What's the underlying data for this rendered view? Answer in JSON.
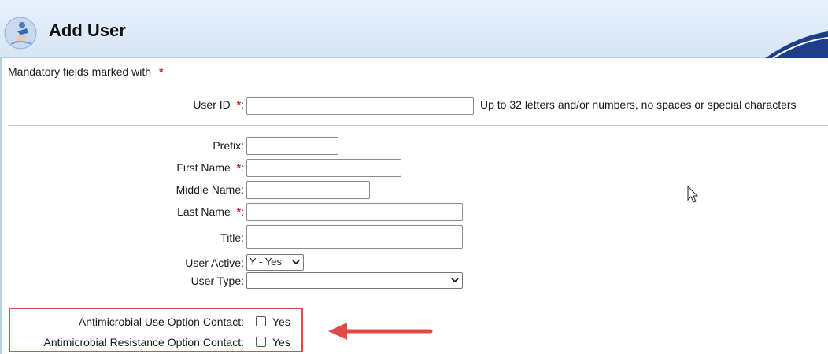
{
  "header": {
    "title": "Add User"
  },
  "mandatory_note": {
    "text": "Mandatory fields marked with",
    "star": "*"
  },
  "user_id": {
    "label": "User ID",
    "colon": ":",
    "value": "",
    "hint": "Up to 32 letters and/or numbers, no spaces or special characters"
  },
  "fields": {
    "prefix": {
      "label": "Prefix",
      "value": ""
    },
    "first_name": {
      "label": "First Name",
      "value": ""
    },
    "middle_name": {
      "label": "Middle Name",
      "value": ""
    },
    "last_name": {
      "label": "Last Name",
      "value": ""
    },
    "title": {
      "label": "Title",
      "value": ""
    },
    "user_active": {
      "label": "User Active",
      "value": "Y - Yes"
    },
    "user_type": {
      "label": "User Type",
      "value": ""
    }
  },
  "required_star": "*",
  "colon": ":",
  "contacts": {
    "use": {
      "label": "Antimicrobial Use Option Contact:",
      "option": "Yes",
      "checked": false
    },
    "resistance": {
      "label": "Antimicrobial Resistance Option Contact:",
      "option": "Yes",
      "checked": false
    }
  },
  "colors": {
    "header_bg": "#d7e6f6",
    "required_star": "#e02020",
    "highlight": "#e24a4a"
  },
  "icons": {
    "logo": "nhsn-logo-icon",
    "select_chevron": "chevron-down-icon",
    "annotation_arrow": "arrow-left-icon",
    "cursor": "mouse-pointer-icon"
  }
}
